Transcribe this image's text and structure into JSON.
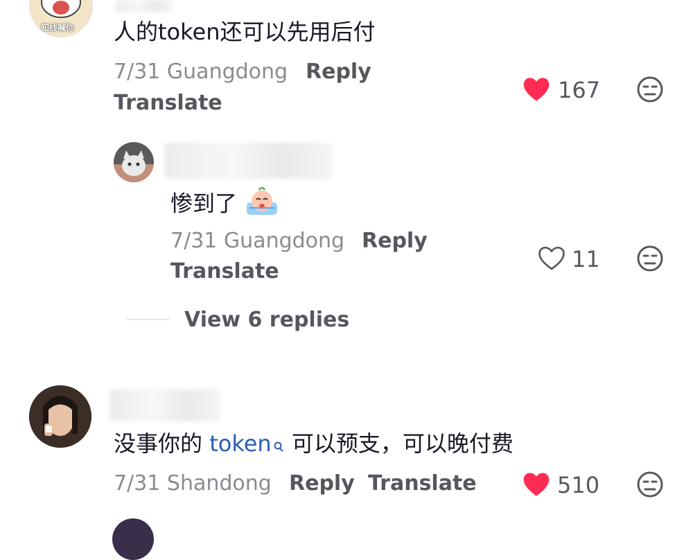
{
  "comments": [
    {
      "text": "人的token还可以先用后付",
      "date": "7/31",
      "location": "Guangdong",
      "reply_label": "Reply",
      "translate_label": "Translate",
      "likes": "167",
      "liked": true,
      "avatar_sticker_text": "知线喊你"
    },
    {
      "text": "惨到了",
      "date": "7/31",
      "location": "Guangdong",
      "reply_label": "Reply",
      "translate_label": "Translate",
      "likes": "11",
      "liked": false
    },
    {
      "text_before": "没事你的",
      "mention": "token",
      "text_after": "可以预支，可以晚付费",
      "date": "7/31",
      "location": "Shandong",
      "reply_label": "Reply",
      "translate_label": "Translate",
      "likes": "510",
      "liked": true
    }
  ],
  "view_replies_label": "View 6 replies",
  "icons": {
    "like": "heart-icon",
    "dislike": "expressionless-face-icon",
    "emoji": "crying-emoji-icon",
    "search": "search-icon"
  },
  "colors": {
    "like_active": "#fe2c55",
    "mention": "#2b5db3",
    "meta": "#8a8b91",
    "action": "#56575e"
  }
}
